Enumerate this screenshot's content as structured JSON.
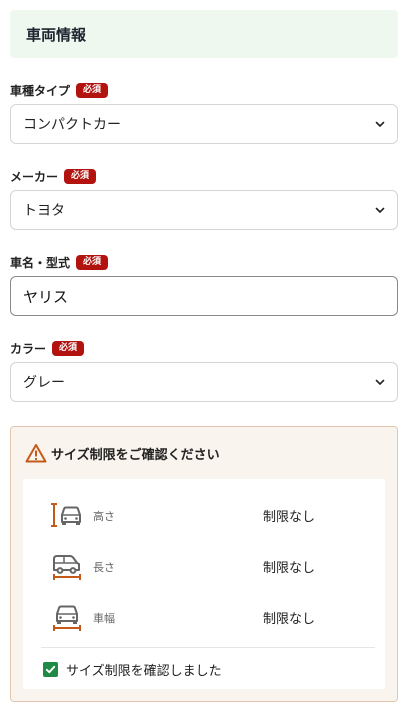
{
  "section": {
    "title": "車両情報"
  },
  "required_badge": "必須",
  "fields": {
    "vehicle_type": {
      "label": "車種タイプ",
      "value": "コンパクトカー"
    },
    "maker": {
      "label": "メーカー",
      "value": "トヨタ"
    },
    "model": {
      "label": "車名・型式",
      "value": "ヤリス"
    },
    "color": {
      "label": "カラー",
      "value": "グレー"
    }
  },
  "notice": {
    "title": "サイズ制限をご確認ください",
    "limits": [
      {
        "name": "高さ",
        "value": "制限なし",
        "icon": "height-icon"
      },
      {
        "name": "長さ",
        "value": "制限なし",
        "icon": "length-icon"
      },
      {
        "name": "車幅",
        "value": "制限なし",
        "icon": "width-icon"
      }
    ],
    "confirm_label": "サイズ制限を確認しました",
    "confirmed": true
  },
  "colors": {
    "header_bg": "#eef8ef",
    "required_badge": "#b3130f",
    "notice_border": "#e6c5ad",
    "warning": "#c45a1a",
    "checkbox": "#1f8a46"
  }
}
